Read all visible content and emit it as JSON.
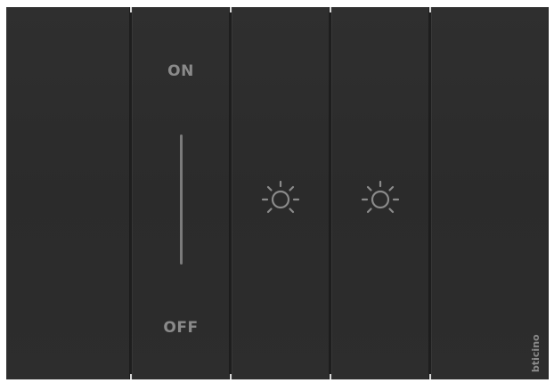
{
  "switch_plate": {
    "modules": [
      {
        "name": "blank-left"
      },
      {
        "name": "on-off-switch",
        "top_label": "ON",
        "bottom_label": "OFF"
      },
      {
        "name": "light-button-1",
        "icon": "sun-icon"
      },
      {
        "name": "light-button-2",
        "icon": "sun-icon"
      },
      {
        "name": "blank-right",
        "brand": "bticino"
      }
    ],
    "colors": {
      "plate": "#2c2c2c",
      "markings": "#8a8a8a",
      "background": "#ffffff"
    }
  }
}
